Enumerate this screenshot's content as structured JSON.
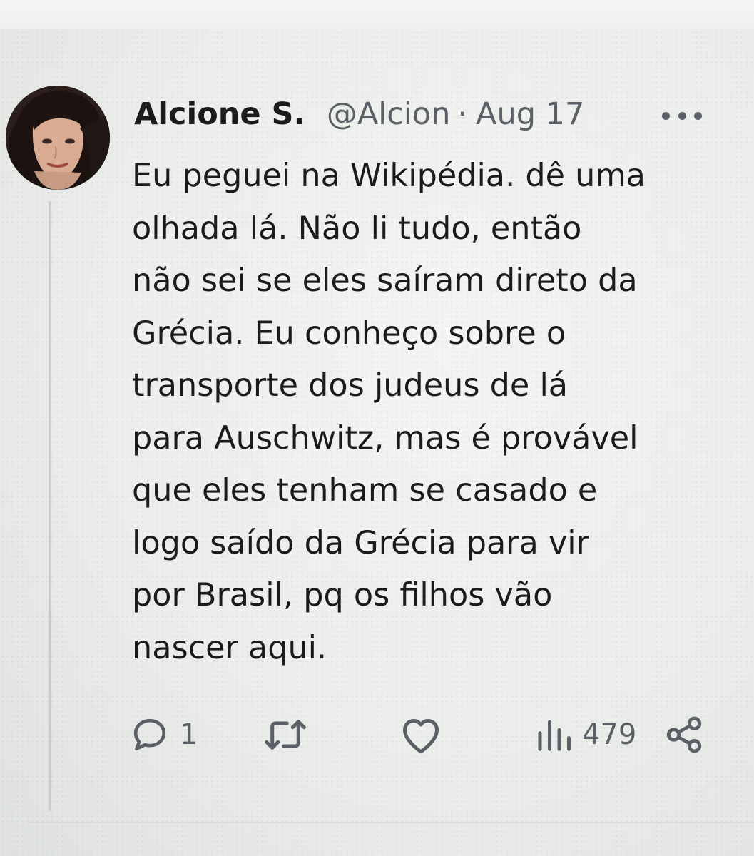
{
  "tweet": {
    "author_name": "Alcione S.",
    "handle": "@Alcion",
    "separator": "·",
    "date": "Aug 17",
    "text": "Eu peguei na Wikipédia. dê uma\nolhada lá. Não li tudo, então\nnão sei se eles saíram direto da\nGrécia. Eu conheço sobre o\ntransporte dos judeus de lá\npara Auschwitz, mas é provável\nque eles tenham  se casado e\nlogo saído da Grécia para vir\npor Brasil, pq os filhos vão\nnascer aqui."
  },
  "actions": {
    "reply_count": "1",
    "repost_count": "",
    "like_count": "",
    "views_count": "479"
  },
  "icons": {
    "more": "more-horizontal-icon",
    "reply": "reply-bubble-icon",
    "repost": "repost-arrows-icon",
    "like": "heart-icon",
    "views": "bar-chart-icon",
    "share": "share-icon"
  },
  "colors": {
    "text": "#1a1c1a",
    "secondary": "#5b6066",
    "thread_line": "#c9ccc9"
  }
}
